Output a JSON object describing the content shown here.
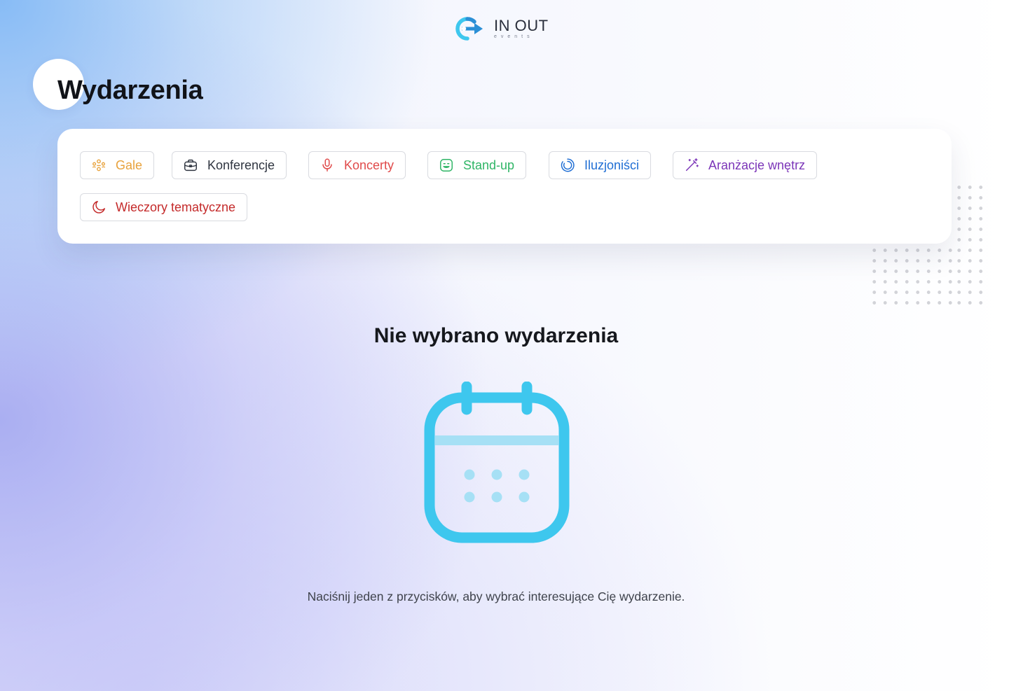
{
  "brand": {
    "name": "IN OUT",
    "tagline": "events"
  },
  "page": {
    "title": "Wydarzenia"
  },
  "categories": [
    {
      "label": "Gale",
      "icon": "people-group-icon",
      "color": "#e8a23c"
    },
    {
      "label": "Konferencje",
      "icon": "briefcase-icon",
      "color": "#2f3540"
    },
    {
      "label": "Koncerty",
      "icon": "microphone-icon",
      "color": "#e04a4a"
    },
    {
      "label": "Stand-up",
      "icon": "smiley-icon",
      "color": "#2fb566"
    },
    {
      "label": "Iluzjoniści",
      "icon": "loader-circle-icon",
      "color": "#1f6ed4"
    },
    {
      "label": "Aranżacje wnętrz",
      "icon": "magic-wand-icon",
      "color": "#7b35b8"
    },
    {
      "label": "Wieczory tematyczne",
      "icon": "moon-icon",
      "color": "#c42a2a"
    }
  ],
  "empty_state": {
    "title": "Nie wybrano wydarzenia",
    "icon": "calendar-icon",
    "description": "Naciśnij jeden z przycisków, aby wybrać interesujące Cię wydarzenie."
  },
  "colors": {
    "accent": "#3ec7ee",
    "accent_light": "#a6e0f5"
  }
}
